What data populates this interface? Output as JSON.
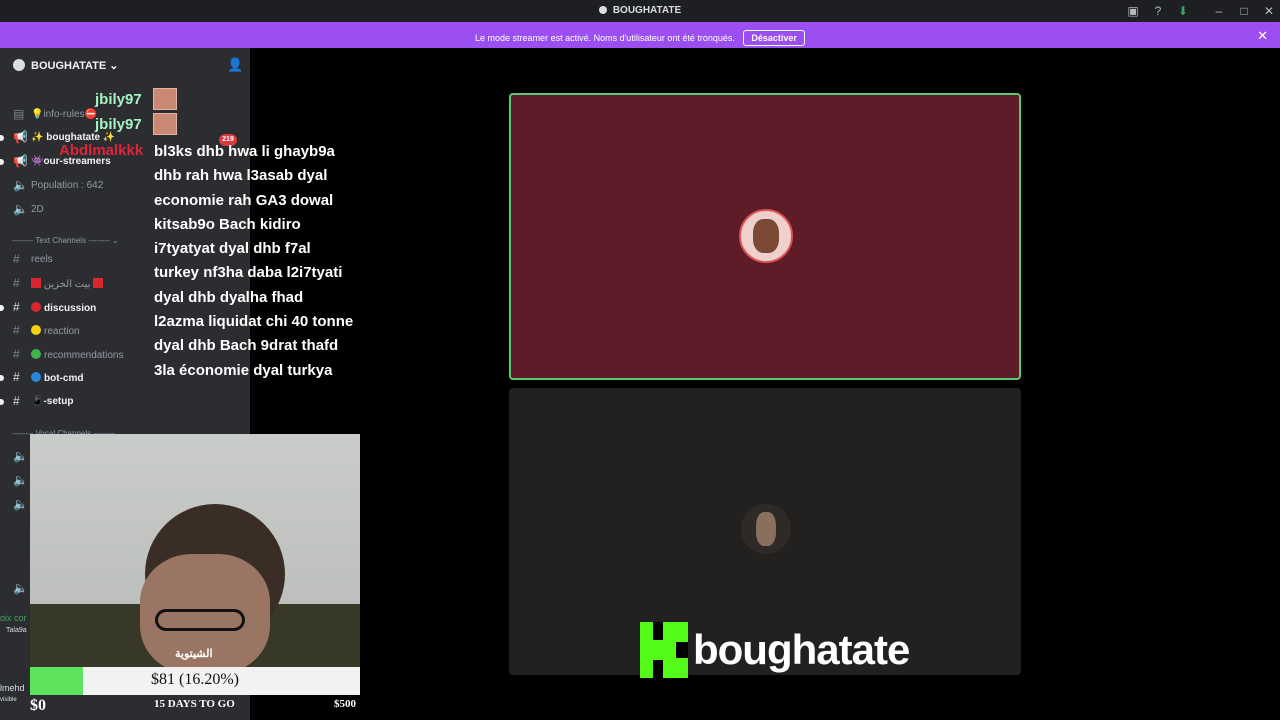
{
  "window": {
    "title": "BOUGHATATE",
    "icons": [
      "screen-share-icon",
      "help-icon",
      "download-icon",
      "minimize-icon",
      "maximize-icon",
      "close-icon"
    ]
  },
  "banner": {
    "message": "Le mode streamer est activé. Noms d'utilisateur ont été tronqués.",
    "button": "Désactiver",
    "color": "#9b4ff0"
  },
  "server": {
    "name": "BOUGHATATE",
    "channels": [
      {
        "icon": "rules-icon",
        "label": "💡info-rules⛔",
        "unread": false
      },
      {
        "icon": "announcement-icon",
        "label": "✨ boughatate ✨",
        "unread": true
      },
      {
        "icon": "announcement-icon",
        "label": "👾our-streamers",
        "unread": true
      },
      {
        "icon": "voice-locked-icon",
        "label": "Population : 642",
        "unread": false
      },
      {
        "icon": "voice-locked-icon",
        "label": "2D",
        "unread": false
      }
    ],
    "text_category": "-------- Text Channels --------",
    "text_channels": [
      {
        "label": "reels",
        "dot": "",
        "unread": false
      },
      {
        "label": "بيت الخزين",
        "dot": "#d8272f",
        "unread": false
      },
      {
        "label": "discussion",
        "dot": "#d8272f",
        "unread": true
      },
      {
        "label": "reaction",
        "dot": "#f5d20c",
        "unread": false
      },
      {
        "label": "recommendations",
        "dot": "#43b14b",
        "unread": false
      },
      {
        "label": "bot-cmd",
        "dot": "#2a86d9",
        "unread": true
      },
      {
        "label": "📱-setup",
        "dot": "",
        "unread": true
      }
    ],
    "voice_category": "-------- Vocal Channels --------",
    "mention_badge": "219"
  },
  "chat": {
    "names": [
      {
        "name": "jbily97",
        "color": "#a7f3c3"
      },
      {
        "name": "jbily97",
        "color": "#a7f3c3"
      },
      {
        "name": "Abdlmalkkk",
        "color": "#e0243c"
      }
    ],
    "message": "bl3ks dhb hwa li ghayb9a dhb rah hwa l3asab dyal economie rah GA3 dowal kitsab9o Bach kidiro i7tyatyat dyal dhb f7al turkey nf3ha daba l2i7tyati dyal dhb dyalha fhad l2azma liquidat chi 40 tonne dyal dhb Bach 9drat thafd 3la économie dyal turkya"
  },
  "side_fragments": [
    "oix cor",
    "Tala9a",
    "lmehd",
    "visible"
  ],
  "webcam": {
    "watermark": "الشيتوية"
  },
  "goal": {
    "current_text": "$81 (16.20%)",
    "progress": 0.162,
    "start": "$0",
    "countdown": "15 DAYS TO GO",
    "target": "$500"
  },
  "voice": {
    "tiles": [
      {
        "speaking": true,
        "bg": "#5d1c27"
      },
      {
        "speaking": false,
        "bg": "#222120"
      }
    ]
  },
  "brand": {
    "platform_logo": "K",
    "channel": "boughatate",
    "accent": "#53fc18"
  }
}
